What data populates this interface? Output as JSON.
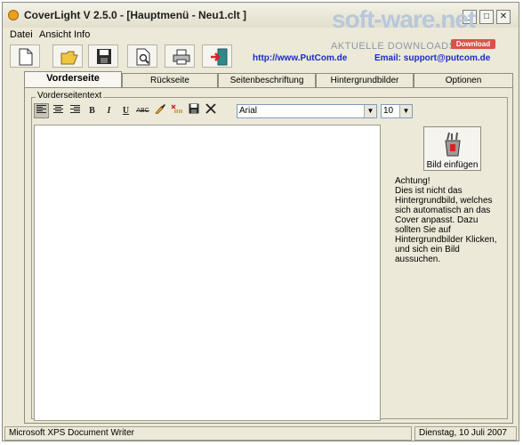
{
  "window": {
    "title": "CoverLight V 2.5.0 - [Hauptmenü - Neu1.clt ]",
    "controls": [
      "minimize",
      "maximize",
      "close"
    ]
  },
  "watermark": {
    "logo": "soft-ware.net",
    "badge": "Download",
    "tagline": "AKTUELLE DOWNLOADS"
  },
  "menu": [
    "Datei",
    "Ansicht",
    "Info"
  ],
  "toolbar": {
    "buttons": [
      "new-document-icon",
      "open-folder-icon",
      "save-disk-icon",
      "print-preview-icon",
      "printer-icon",
      "exit-door-icon"
    ],
    "website": "http://www.PutCom.de",
    "email": "Email: support@putcom.de"
  },
  "tabs": [
    {
      "label": "Vorderseite",
      "active": true
    },
    {
      "label": "Rückseite",
      "active": false
    },
    {
      "label": "Seitenbeschriftung",
      "active": false
    },
    {
      "label": "Hintergrundbilder",
      "active": false
    },
    {
      "label": "Optionen",
      "active": false
    }
  ],
  "panel": {
    "group_label": "Vorderseitentext",
    "format_buttons": [
      "B",
      "I",
      "U",
      "ABC"
    ],
    "font": "Arial",
    "size": "10",
    "insert_image_label": "Bild einfügen",
    "note": "Achtung!\nDies ist nicht das\nHintergrundbild, welches\nsich automatisch an das\nCover anpasst. Dazu\nsollten Sie auf\nHintergrundbilder Klicken,\nund sich ein Bild\naussuchen."
  },
  "status": {
    "printer": "Microsoft XPS Document Writer",
    "date": "Dienstag, 10 Juli 2007"
  },
  "colors": {
    "window_bg": "#ece9d8",
    "link": "#1a2bc9"
  }
}
